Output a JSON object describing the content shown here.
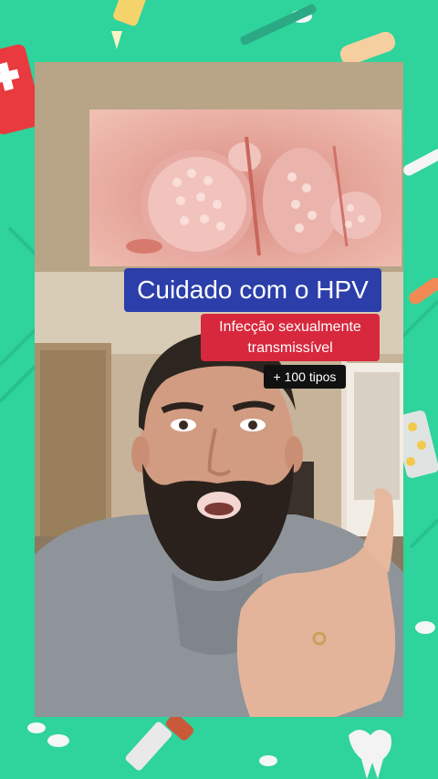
{
  "overlay": {
    "title": "Cuidado com o HPV",
    "subtitle_line1": "Infecção sexualmente",
    "subtitle_line2": "transmissível",
    "tag": "+ 100 tipos"
  },
  "icons": [
    "first-aid-kit-icon",
    "pill-icon",
    "thermometer-icon",
    "syringe-icon",
    "dropper-icon",
    "tooth-icon",
    "bandage-icon",
    "pill-blister-icon"
  ],
  "colors": {
    "background": "#2fd39c",
    "title_box": "#2b3ea9",
    "subtitle_box": "#d7283d",
    "tag_box": "#111111"
  }
}
